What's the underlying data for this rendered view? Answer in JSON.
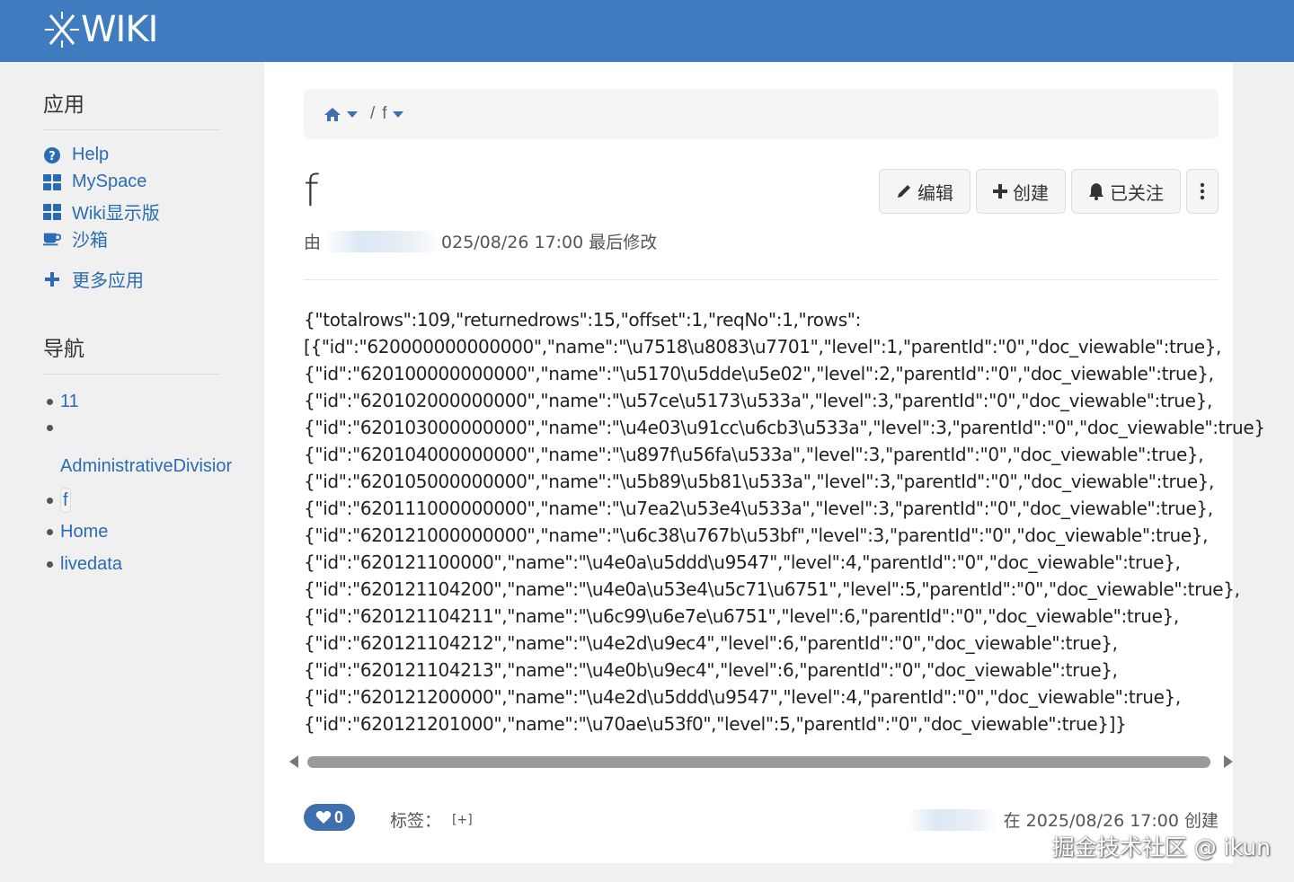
{
  "header": {
    "logo_text": "WIKI"
  },
  "sidebar": {
    "apps_heading": "应用",
    "apps": [
      {
        "label": "Help",
        "icon": "question-circle-icon"
      },
      {
        "label": "MySpace",
        "icon": "grid-icon"
      },
      {
        "label": "Wiki显示版",
        "icon": "grid-icon"
      },
      {
        "label": "沙箱",
        "icon": "coffee-cup-icon"
      }
    ],
    "more_apps": "更多应用",
    "nav_heading": "导航",
    "nav": [
      "11",
      "AdministrativeDivisior",
      "f",
      "Home",
      "livedata"
    ]
  },
  "breadcrumb": {
    "current": "f",
    "separator": "/"
  },
  "page": {
    "title": "f",
    "buttons": {
      "edit": "编辑",
      "create": "创建",
      "watch": "已关注"
    },
    "modified_by_prefix": "由",
    "modified_text": "025/08/26 17:00 最后修改",
    "content_lines": [
      "{\"totalrows\":109,\"returnedrows\":15,\"offset\":1,\"reqNo\":1,\"rows\":",
      "[{\"id\":\"620000000000000\",\"name\":\"\\u7518\\u8083\\u7701\",\"level\":1,\"parentId\":\"0\",\"doc_viewable\":true},",
      "{\"id\":\"620100000000000\",\"name\":\"\\u5170\\u5dde\\u5e02\",\"level\":2,\"parentId\":\"0\",\"doc_viewable\":true},",
      "{\"id\":\"620102000000000\",\"name\":\"\\u57ce\\u5173\\u533a\",\"level\":3,\"parentId\":\"0\",\"doc_viewable\":true},",
      "{\"id\":\"620103000000000\",\"name\":\"\\u4e03\\u91cc\\u6cb3\\u533a\",\"level\":3,\"parentId\":\"0\",\"doc_viewable\":true}",
      "{\"id\":\"620104000000000\",\"name\":\"\\u897f\\u56fa\\u533a\",\"level\":3,\"parentId\":\"0\",\"doc_viewable\":true},",
      "{\"id\":\"620105000000000\",\"name\":\"\\u5b89\\u5b81\\u533a\",\"level\":3,\"parentId\":\"0\",\"doc_viewable\":true},",
      "{\"id\":\"620111000000000\",\"name\":\"\\u7ea2\\u53e4\\u533a\",\"level\":3,\"parentId\":\"0\",\"doc_viewable\":true},",
      "{\"id\":\"620121000000000\",\"name\":\"\\u6c38\\u767b\\u53bf\",\"level\":3,\"parentId\":\"0\",\"doc_viewable\":true},",
      "{\"id\":\"620121100000\",\"name\":\"\\u4e0a\\u5ddd\\u9547\",\"level\":4,\"parentId\":\"0\",\"doc_viewable\":true},",
      "{\"id\":\"620121104200\",\"name\":\"\\u4e0a\\u53e4\\u5c71\\u6751\",\"level\":5,\"parentId\":\"0\",\"doc_viewable\":true},",
      "{\"id\":\"620121104211\",\"name\":\"\\u6c99\\u6e7e\\u6751\",\"level\":6,\"parentId\":\"0\",\"doc_viewable\":true},",
      "{\"id\":\"620121104212\",\"name\":\"\\u4e2d\\u9ec4\",\"level\":6,\"parentId\":\"0\",\"doc_viewable\":true},",
      "{\"id\":\"620121104213\",\"name\":\"\\u4e0b\\u9ec4\",\"level\":6,\"parentId\":\"0\",\"doc_viewable\":true},",
      "{\"id\":\"620121200000\",\"name\":\"\\u4e2d\\u5ddd\\u9547\",\"level\":4,\"parentId\":\"0\",\"doc_viewable\":true},",
      "{\"id\":\"620121201000\",\"name\":\"\\u70ae\\u53f0\",\"level\":5,\"parentId\":\"0\",\"doc_viewable\":true}]}"
    ],
    "likes": "0",
    "tags_label": "标签：",
    "tags_add": "[+]",
    "created_text": "在 2025/08/26 17:00 创建"
  },
  "watermark": "掘金技术社区 @ ikun",
  "colors": {
    "header": "#3e7cbf",
    "link": "#2a6cb3",
    "like": "#3e6fae"
  }
}
